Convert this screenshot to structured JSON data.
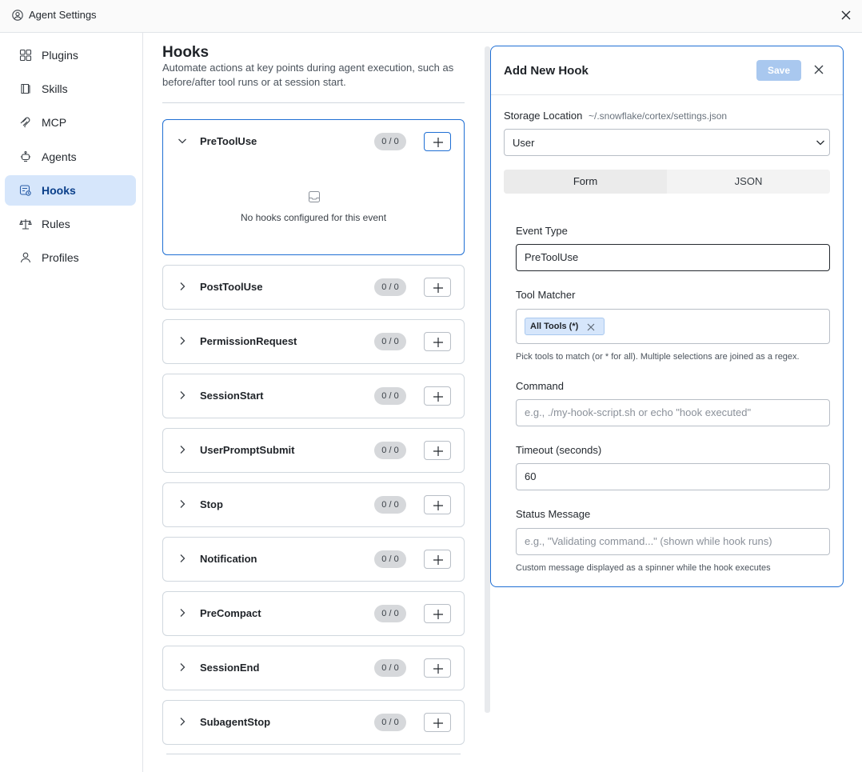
{
  "window": {
    "title": "Agent Settings"
  },
  "sidebar": {
    "items": [
      {
        "label": "Plugins",
        "icon": "plugin-icon"
      },
      {
        "label": "Skills",
        "icon": "book-icon"
      },
      {
        "label": "MCP",
        "icon": "mcp-icon"
      },
      {
        "label": "Agents",
        "icon": "agent-icon"
      },
      {
        "label": "Hooks",
        "icon": "hook-icon",
        "active": true
      },
      {
        "label": "Rules",
        "icon": "scale-icon"
      },
      {
        "label": "Profiles",
        "icon": "user-icon"
      }
    ]
  },
  "main": {
    "title": "Hooks",
    "description": "Automate actions at key points during agent execution, such as before/after tool runs or at session start.",
    "events": [
      {
        "name": "PreToolUse",
        "count": "0 / 0",
        "expanded": true,
        "empty_text": "No hooks configured for this event"
      },
      {
        "name": "PostToolUse",
        "count": "0 / 0"
      },
      {
        "name": "PermissionRequest",
        "count": "0 / 0"
      },
      {
        "name": "SessionStart",
        "count": "0 / 0"
      },
      {
        "name": "UserPromptSubmit",
        "count": "0 / 0"
      },
      {
        "name": "Stop",
        "count": "0 / 0"
      },
      {
        "name": "Notification",
        "count": "0 / 0"
      },
      {
        "name": "PreCompact",
        "count": "0 / 0"
      },
      {
        "name": "SessionEnd",
        "count": "0 / 0"
      },
      {
        "name": "SubagentStop",
        "count": "0 / 0"
      }
    ]
  },
  "panel": {
    "title": "Add New Hook",
    "save_label": "Save",
    "storage_label": "Storage Location",
    "storage_path": "~/.snowflake/cortex/settings.json",
    "storage_value": "User",
    "tabs": {
      "form": "Form",
      "json": "JSON"
    },
    "event_type_label": "Event Type",
    "event_type_value": "PreToolUse",
    "tool_matcher_label": "Tool Matcher",
    "tool_chip": "All Tools (*)",
    "tool_hint": "Pick tools to match (or * for all). Multiple selections are joined as a regex.",
    "command_label": "Command",
    "command_placeholder": "e.g., ./my-hook-script.sh or echo \"hook executed\"",
    "timeout_label": "Timeout (seconds)",
    "timeout_value": "60",
    "status_label": "Status Message",
    "status_placeholder": "e.g., \"Validating command...\" (shown while hook runs)",
    "status_hint": "Custom message displayed as a spinner while the hook executes"
  },
  "colors": {
    "accent": "#1f6fd4",
    "active_bg": "#d6e6fb",
    "save_disabled": "#a9c8ef"
  }
}
